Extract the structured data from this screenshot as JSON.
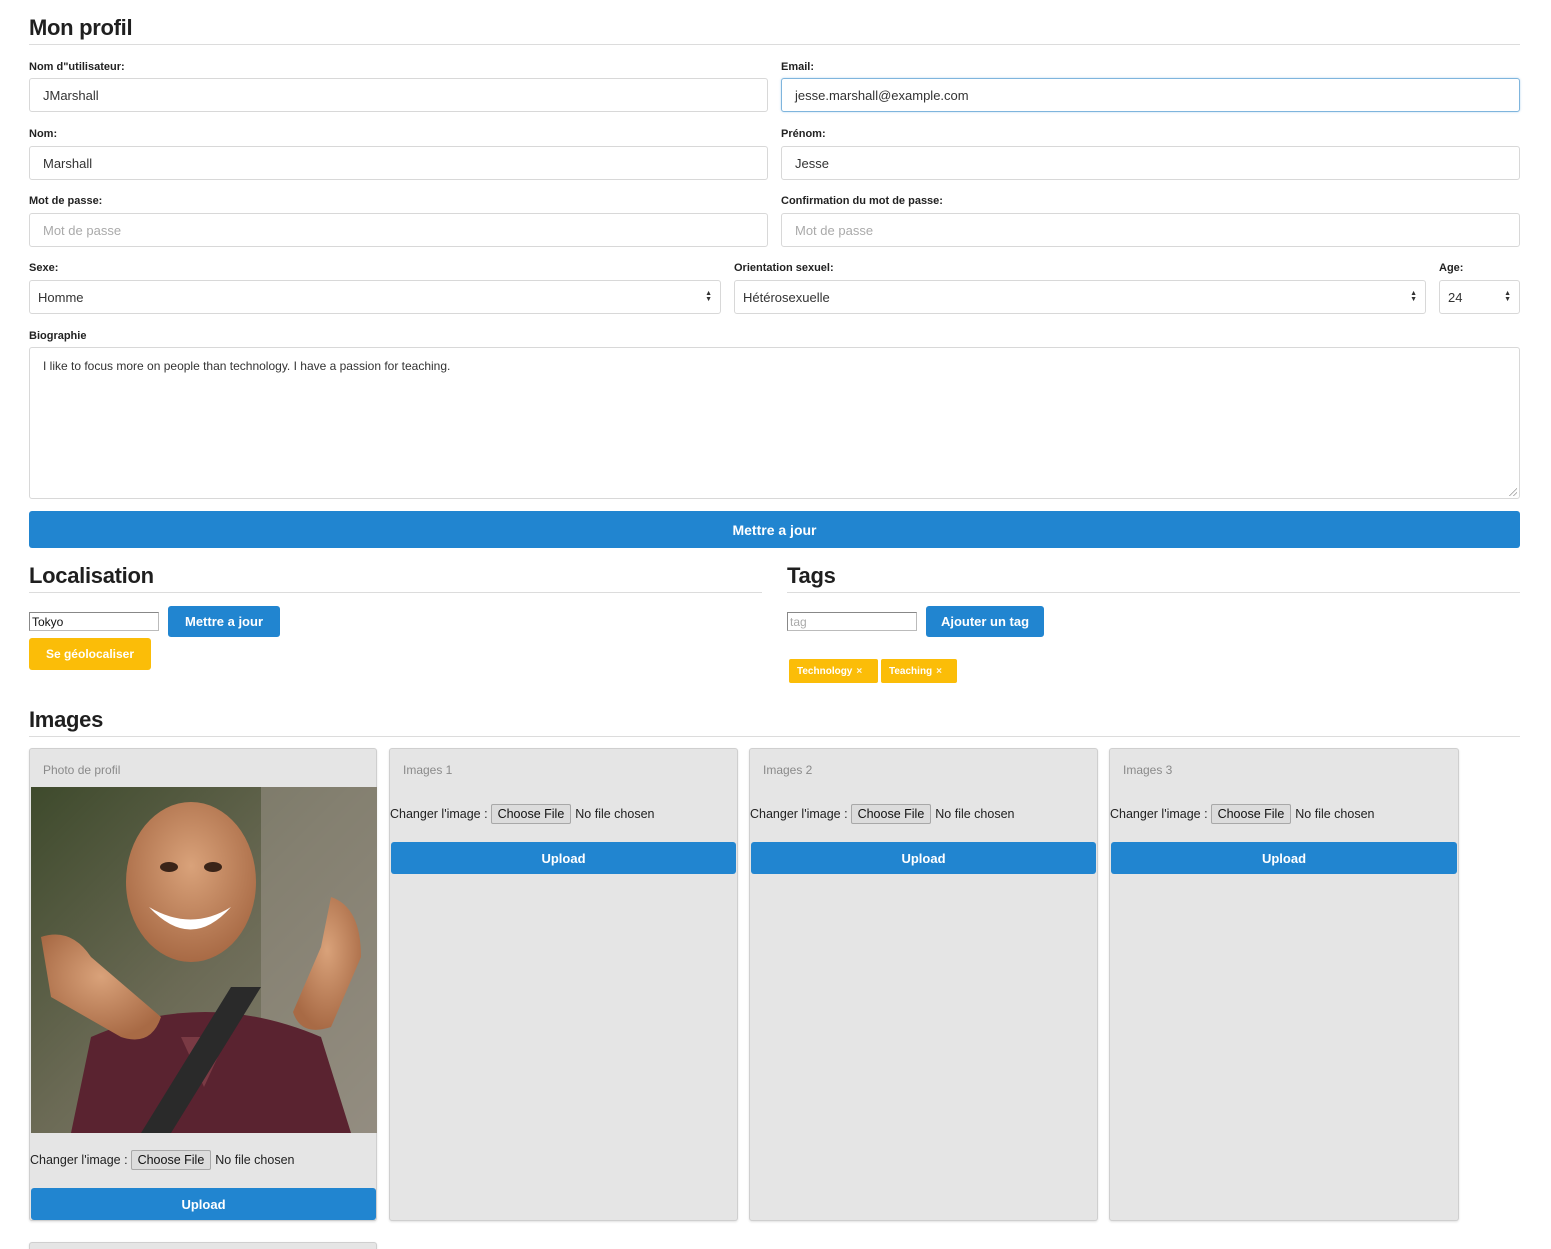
{
  "profile": {
    "title": "Mon profil",
    "username_label": "Nom d\"utilisateur:",
    "username_value": "JMarshall",
    "email_label": "Email:",
    "email_value": "jesse.marshall@example.com",
    "lastname_label": "Nom:",
    "lastname_value": "Marshall",
    "firstname_label": "Prénom:",
    "firstname_value": "Jesse",
    "password_label": "Mot de passe:",
    "password_placeholder": "Mot de passe",
    "password_confirm_label": "Confirmation du mot de passe:",
    "password_confirm_placeholder": "Mot de passe",
    "sex_label": "Sexe:",
    "sex_value": "Homme",
    "orientation_label": "Orientation sexuel:",
    "orientation_value": "Hétérosexuelle",
    "age_label": "Age:",
    "age_value": "24",
    "bio_label": "Biographie",
    "bio_value": "I like to focus more on people than technology. I have a passion for teaching.",
    "update_button": "Mettre a jour"
  },
  "location": {
    "title": "Localisation",
    "city_value": "Tokyo",
    "update_button": "Mettre a jour",
    "geolocate_button": "Se géolocaliser"
  },
  "tags": {
    "title": "Tags",
    "input_placeholder": "tag",
    "add_button": "Ajouter un tag",
    "items": [
      {
        "label": "Technology",
        "remove": "×"
      },
      {
        "label": "Teaching",
        "remove": "×"
      }
    ]
  },
  "images": {
    "title": "Images",
    "change_label": "Changer l'image :",
    "choose_file": "Choose File",
    "no_file": "No file chosen",
    "upload_button": "Upload",
    "cards": [
      {
        "title": "Photo de profil"
      },
      {
        "title": "Images 1"
      },
      {
        "title": "Images 2"
      },
      {
        "title": "Images 3"
      }
    ]
  },
  "colors": {
    "primary": "#2185d0",
    "warning": "#fbbd08",
    "card_bg": "#e5e5e5"
  }
}
